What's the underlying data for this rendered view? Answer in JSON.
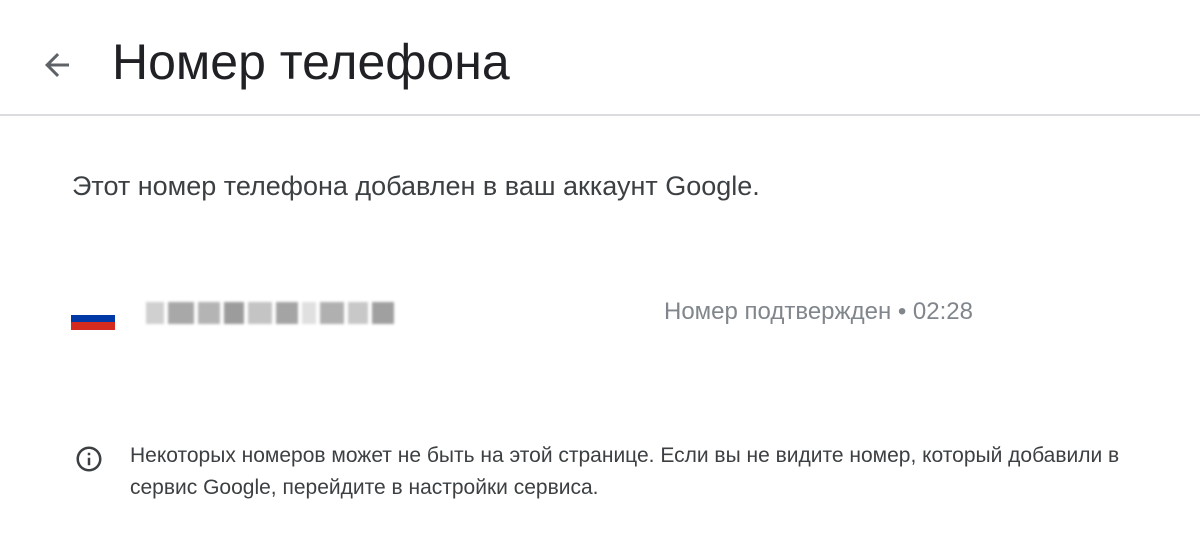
{
  "header": {
    "back_icon": "arrow-back-icon",
    "title": "Номер телефона"
  },
  "main": {
    "intro": "Этот номер телефона добавлен в ваш аккаунт Google.",
    "phone": {
      "country_flag_icon": "russia-flag-icon",
      "flag_colors": [
        "#ffffff",
        "#0039a6",
        "#d52b1e"
      ],
      "status": "Номер подтвержден • 02:28"
    },
    "info": {
      "icon": "info-icon",
      "text": "Некоторых номеров может не быть на этой странице. Если вы не видите номер, который добавили в сервис Google, перейдите в настройки сервиса."
    }
  },
  "colors": {
    "divider": "#dadce0",
    "secondary_text": "#80868b",
    "primary_text": "#202124"
  }
}
